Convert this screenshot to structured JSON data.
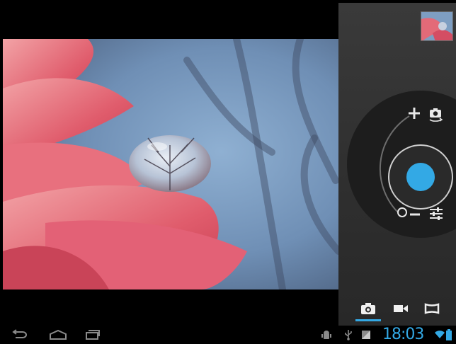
{
  "camera": {
    "mode": "photo",
    "shutter_color": "#33a9e5",
    "accent": "#33a9e5"
  },
  "controls": {
    "zoom_in_icon": "plus-icon",
    "zoom_out_icon": "minus-icon",
    "switch_camera_icon": "switch-camera-icon",
    "settings_icon": "sliders-icon",
    "zoom_level": 0
  },
  "modes": [
    {
      "name": "photo",
      "icon": "camera-icon",
      "active": true
    },
    {
      "name": "video",
      "icon": "video-camera-icon",
      "active": false
    },
    {
      "name": "panorama",
      "icon": "panorama-icon",
      "active": false
    }
  ],
  "navbar": {
    "back_icon": "back-icon",
    "home_icon": "home-icon",
    "recents_icon": "recent-apps-icon"
  },
  "status": {
    "time": "18:03",
    "icons": [
      "android-debug-icon",
      "usb-icon",
      "gallery-notification-icon",
      "wifi-icon",
      "battery-icon"
    ]
  }
}
